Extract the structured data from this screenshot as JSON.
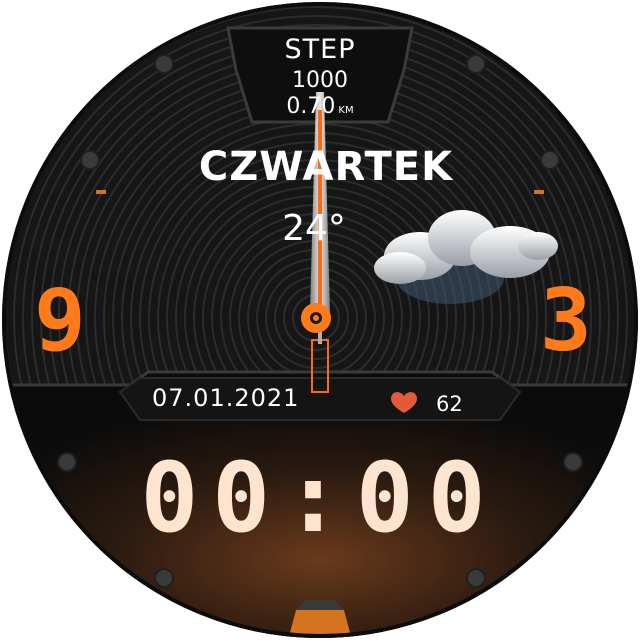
{
  "steps": {
    "title": "STEP",
    "count": "1000",
    "distance": "0.70",
    "distance_unit": "KM"
  },
  "weekday": "CZWARTEK",
  "weather": {
    "temperature": "24°",
    "icon": "cloud-rain-icon"
  },
  "markers": {
    "left": "9",
    "right": "3"
  },
  "date": "07.01.2021",
  "heart_rate": {
    "value": "62",
    "icon": "heart-icon"
  },
  "digital_time": "00:00",
  "colors": {
    "accent": "#ff7a1a",
    "digit": "#ffe4cf",
    "background": "#111111",
    "heart": "#e35a3a"
  }
}
